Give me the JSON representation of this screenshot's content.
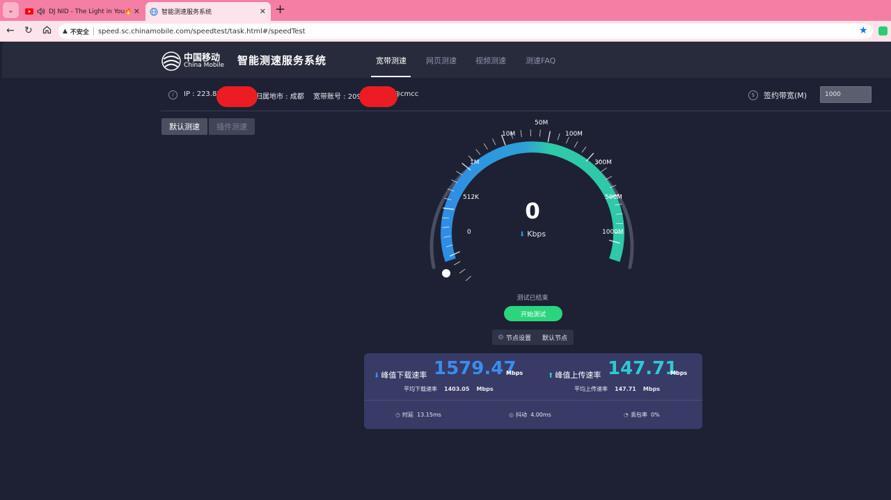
{
  "browser": {
    "tabs": [
      {
        "title": "DJ NID - The Light in You🔥🤍",
        "favicon": "youtube-icon",
        "audio": "speaker-icon"
      },
      {
        "title": "智能测速服务系统",
        "favicon": "globe-icon"
      }
    ],
    "new_tab": "+",
    "address": {
      "security_label": "不安全",
      "url": "speed.sc.chinamobile.com/speedtest/task.html#/speedTest"
    }
  },
  "header": {
    "brand_cn": "中国移动",
    "brand_en": "China Mobile",
    "system_title": "智能测速服务系统",
    "nav": [
      "宽带测速",
      "网页测速",
      "视频测速",
      "测速FAQ"
    ]
  },
  "info": {
    "ip": "IP : 223.85",
    "city": "归属地市 : 成都",
    "account": "宽带账号 : 209",
    "account_suffix": "@cmcc",
    "bandwidth_label": "签约带宽(M)",
    "bandwidth_value": "1000"
  },
  "modes": {
    "default": "默认测速",
    "plugin": "插件测速"
  },
  "gauge": {
    "current_value": "0",
    "unit": "Kbps",
    "scale_labels": [
      "0",
      "512K",
      "1M",
      "10M",
      "50M",
      "100M",
      "300M",
      "500M",
      "1000M"
    ],
    "colors": {
      "blue": "#2f8de4",
      "teal": "#2ec9a8",
      "track": "#2b2f42",
      "outer": "#4a4e62"
    }
  },
  "status": "测试已结束",
  "start_button": "开始测试",
  "node": {
    "settings": "节点设置",
    "default": "默认节点"
  },
  "results": {
    "download": {
      "label": "峰值下载速率",
      "value": "1579.47",
      "unit": "Mbps",
      "avg_label": "平均下载速率",
      "avg_value": "1403.05",
      "avg_unit": "Mbps",
      "color": "#3a8df0"
    },
    "upload": {
      "label": "峰值上传速率",
      "value": "147.71",
      "unit": "Mbps",
      "avg_label": "平均上传速率",
      "avg_value": "147.71",
      "avg_unit": "Mbps",
      "color": "#2ec9d6"
    },
    "latency": {
      "label": "时延",
      "value": "13.15ms"
    },
    "jitter": {
      "label": "抖动",
      "value": "4.00ms"
    },
    "loss": {
      "label": "丢包率",
      "value": "0%"
    }
  }
}
